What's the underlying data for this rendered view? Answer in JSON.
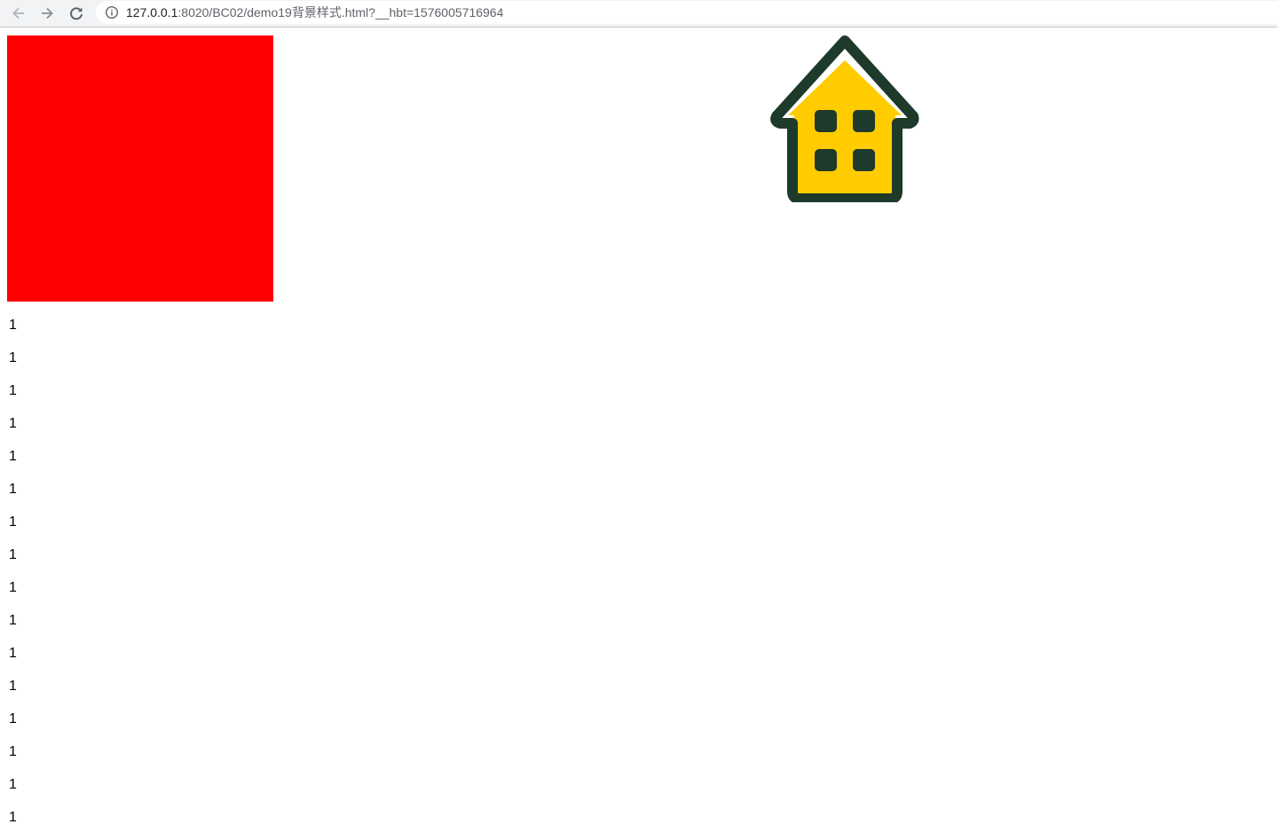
{
  "browser": {
    "url_host": "127.0.0.1",
    "url_rest": ":8020/BC02/demo19背景样式.html?__hbt=1576005716964",
    "back_icon": "arrow-left-icon",
    "forward_icon": "arrow-right-icon",
    "reload_icon": "reload-icon",
    "info_icon": "info-icon"
  },
  "page": {
    "box_color": "#ff0000",
    "image_icon": "house-icon",
    "lines": [
      "1",
      "1",
      "1",
      "1",
      "1",
      "1",
      "1",
      "1",
      "1",
      "1",
      "1",
      "1",
      "1",
      "1",
      "1",
      "1"
    ]
  }
}
